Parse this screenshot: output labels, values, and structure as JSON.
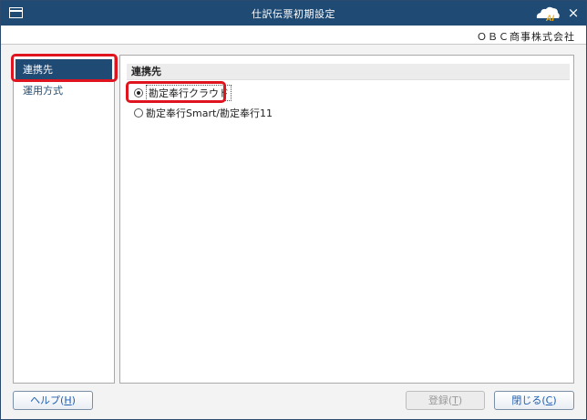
{
  "window": {
    "title": "仕訳伝票初期設定",
    "close_glyph": "×",
    "logo_text": "AI"
  },
  "company": "ＯＢＣ商事株式会社",
  "sidebar": {
    "items": [
      {
        "label": "連携先",
        "active": true
      },
      {
        "label": "運用方式",
        "active": false
      }
    ]
  },
  "content": {
    "section_title": "連携先",
    "options": [
      {
        "label": "勘定奉行クラウド",
        "selected": true
      },
      {
        "label": "勘定奉行Smart/勘定奉行11",
        "selected": false
      }
    ]
  },
  "buttons": {
    "help": {
      "text": "ヘルプ(",
      "key": "H",
      "end": ")"
    },
    "register": {
      "text": "登録(",
      "key": "T",
      "end": ")"
    },
    "close": {
      "text": "閉じる(",
      "key": "C",
      "end": ")"
    }
  },
  "colors": {
    "titlebar": "#1f4a73",
    "highlight": "#e0141e",
    "link": "#1f5fb0"
  }
}
